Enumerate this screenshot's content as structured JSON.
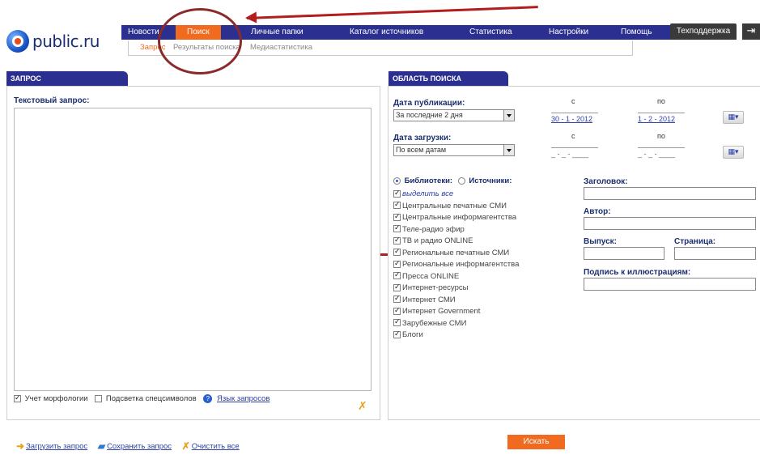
{
  "logo": {
    "text": "public.ru"
  },
  "nav": {
    "items": [
      {
        "label": "Новости"
      },
      {
        "label": "Поиск",
        "active": true
      },
      {
        "label": "Личные папки"
      },
      {
        "label": "Каталог источников"
      },
      {
        "label": "Статистика"
      },
      {
        "label": "Настройки"
      },
      {
        "label": "Помощь"
      }
    ],
    "techsupport": "Техподдержка",
    "exit_icon": "exit-icon"
  },
  "subnav": {
    "items": [
      {
        "label": "Запрос",
        "active": true
      },
      {
        "label": "Результаты поиска"
      },
      {
        "label": "Медиастатистика"
      }
    ]
  },
  "query_panel": {
    "tab": "ЗАПРОС",
    "text_label": "Текстовый запрос:",
    "morphology_label": "Учет морфологии",
    "morphology_checked": true,
    "highlight_label": "Подсветка спецсимволов",
    "highlight_checked": false,
    "query_language_link": "Язык запросов"
  },
  "area_panel": {
    "tab": "ОБЛАСТЬ ПОИСКА",
    "pub_date": {
      "label": "Дата публикации:",
      "select": "За последние 2 дня",
      "from_label": "с",
      "to_label": "по",
      "from": "30 - 1 - 2012",
      "to": "1 - 2 - 2012"
    },
    "load_date": {
      "label": "Дата загрузки:",
      "select": "По всем датам",
      "from_label": "с",
      "to_label": "по",
      "from": "_ - _ - ____",
      "to": "_ - _ - ____"
    },
    "libraries_label": "Библиотеки:",
    "sources_label": "Источники:",
    "select_all": "выделить все",
    "sources": [
      "Центральные печатные СМИ",
      "Центральные информагентства",
      "Теле-радио эфир",
      "ТВ и радио ONLINE",
      "Региональные печатные СМИ",
      "Региональные информагентства",
      "Пресса ONLINE",
      "Интернет-ресурсы",
      "Интернет СМИ",
      "Интернет Government",
      "Зарубежные СМИ",
      "Блоги"
    ],
    "title_label": "Заголовок:",
    "author_label": "Автор:",
    "issue_label": "Выпуск:",
    "page_label": "Страница:",
    "caption_label": "Подпись к иллюстрациям:"
  },
  "bottom": {
    "load_query": "Загрузить запрос",
    "save_query": "Сохранить запрос",
    "clear_all": "Очистить все",
    "search_button": "Искать"
  },
  "colors": {
    "nav_bg": "#2b2f8f",
    "accent": "#f06a1f",
    "annotation": "#b31d1d"
  }
}
